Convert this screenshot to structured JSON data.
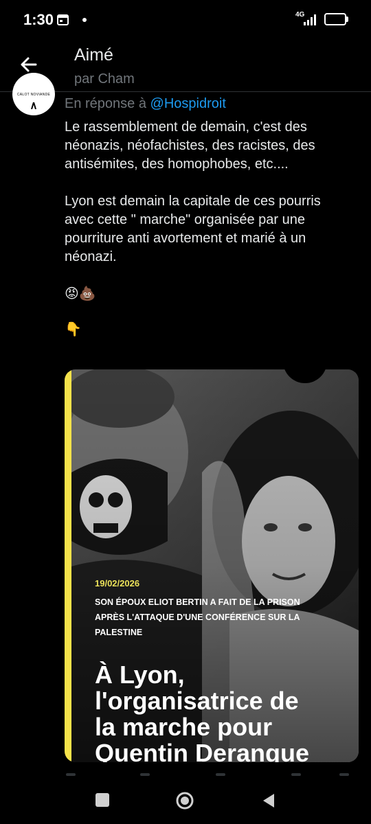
{
  "status_bar": {
    "time": "1:30",
    "network_type": "4G",
    "battery_level": "94",
    "battery_fraction": 0.94,
    "icons": [
      "calendar-icon",
      "signal-icon",
      "battery-icon"
    ]
  },
  "header": {
    "title": "Aimé",
    "subtitle": "par Cham",
    "back_icon": "arrow-left-icon"
  },
  "post": {
    "avatar_text": "CALOT NOVIANDE",
    "reply_prefix": "En réponse à",
    "reply_handle": "@Hospidroit",
    "paragraph_1": "Le rassemblement de demain, c'est des néonazis, néofachistes, des racistes, des antisémites, des homophobes, etc....",
    "paragraph_2": "Lyon est demain la capitale de ces pourris avec cette \" marche\" organisée par une pourriture anti avortement et marié à un néonazi.",
    "emojis_1": "😡💩",
    "emojis_2": "👇"
  },
  "media": {
    "date": "19/02/2026",
    "kicker": "SON ÉPOUX ELIOT BERTIN A FAIT DE LA PRISON APRÈS L'ATTAQUE D'UNE CONFÉRENCE SUR LA PALESTINE",
    "headline_lines": [
      "À Lyon,",
      "l'organisatrice de",
      "la marche pour",
      "Quentin Deranque"
    ],
    "accent_color": "#f5e24a"
  },
  "colors": {
    "background": "#000000",
    "text": "#e7e9ea",
    "muted": "#71767b",
    "link": "#1d9bf0"
  },
  "nav_bar": {
    "icons": [
      "recent-apps-icon",
      "home-icon",
      "back-triangle-icon"
    ]
  }
}
